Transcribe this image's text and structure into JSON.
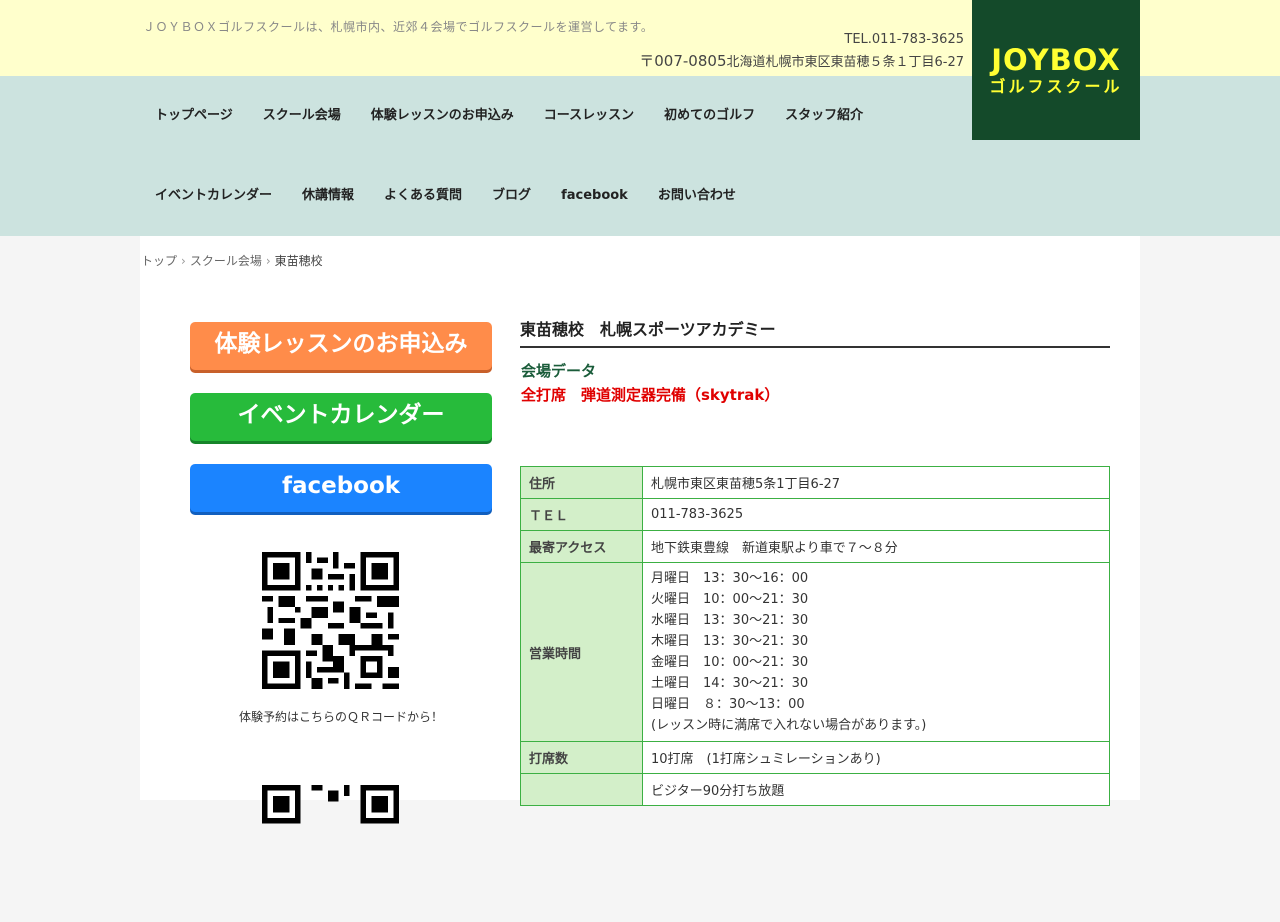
{
  "header": {
    "tagline": "ＪＯＹＢＯＸゴルフスクールは、札幌市内、近郊４会場でゴルフスクールを運営してます。",
    "tel": "TEL.011-783-3625",
    "zip": "〒007-0805",
    "address": "北海道札幌市東区東苗穂５条１丁目6-27",
    "logo_line1": "JOYBOX",
    "logo_line2": "ゴルフスクール"
  },
  "nav": {
    "row1": [
      "トップページ",
      "スクール会場",
      "体験レッスンのお申込み",
      "コースレッスン",
      "初めてのゴルフ",
      "スタッフ紹介"
    ],
    "row2": [
      "イベントカレンダー",
      "休講情報",
      "よくある質問",
      "ブログ",
      "facebook",
      "お問い合わせ"
    ]
  },
  "breadcrumb": {
    "items": [
      "トップ",
      "スクール会場",
      "東苗穂校"
    ],
    "separator": "›"
  },
  "sidebar": {
    "trial_button": "体験レッスンのお申込み",
    "event_button": "イベントカレンダー",
    "facebook_button": "facebook",
    "qr_caption": "体験予約はこちらのＱＲコードから！"
  },
  "main": {
    "title": "東苗穂校　札幌スポーツアカデミー",
    "data_heading": "会場データ",
    "data_note": "全打席　弾道測定器完備（skytrak）",
    "table": {
      "address_label": "住所",
      "address_value": "札幌市東区東苗穂5条1丁目6-27",
      "tel_label": "ＴＥＬ",
      "tel_value": "011-783-3625",
      "access_label": "最寄アクセス",
      "access_value": "地下鉄東豊線　新道東駅より車で７～８分",
      "hours_label": "営業時間",
      "hours": [
        "月曜日　13：30～16：00",
        "火曜日　10：00～21：30",
        "水曜日　13：30～21：30",
        "木曜日　13：30～21：30",
        "金曜日　10：00～21：30",
        "土曜日　14：30～21：30",
        "日曜日　８：30～13：00",
        "(レッスン時に満席で入れない場合があります。)"
      ],
      "booths_label": "打席数",
      "booths_value": "10打席　(1打席シュミレーションあり)",
      "fee_value": "ビジター90分打ち放題"
    }
  },
  "colors": {
    "top_band": "#ffffcc",
    "nav_band": "#cce3df",
    "logo_bg": "#144a2a",
    "logo_text": "#ffff33",
    "trial_button": "#ff8c4a",
    "event_button": "#27bb3b",
    "facebook_button": "#1b84ff",
    "table_border": "#3cb043",
    "table_header_bg": "#d3efc9",
    "data_heading": "#1a5c3a",
    "data_note": "#e00000"
  }
}
